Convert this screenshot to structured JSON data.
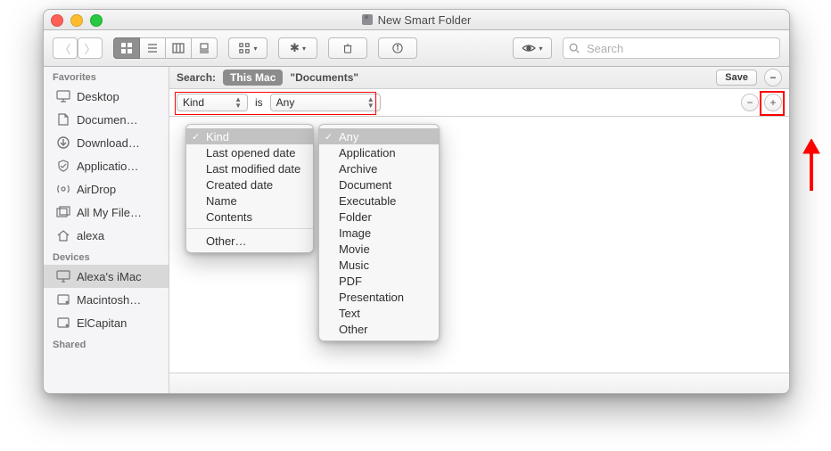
{
  "window": {
    "title": "New Smart Folder"
  },
  "toolbar": {
    "search_placeholder": "Search"
  },
  "sidebar": {
    "groups": [
      {
        "header": "Favorites",
        "items": [
          {
            "label": "Desktop",
            "icon": "desktop"
          },
          {
            "label": "Documen…",
            "icon": "document"
          },
          {
            "label": "Download…",
            "icon": "download"
          },
          {
            "label": "Applicatio…",
            "icon": "app"
          },
          {
            "label": "AirDrop",
            "icon": "airdrop"
          },
          {
            "label": "All My File…",
            "icon": "allfiles"
          },
          {
            "label": "alexa",
            "icon": "home"
          }
        ]
      },
      {
        "header": "Devices",
        "items": [
          {
            "label": "Alexa's iMac",
            "icon": "imac",
            "selected": true
          },
          {
            "label": "Macintosh…",
            "icon": "hdd"
          },
          {
            "label": "ElCapitan",
            "icon": "hdd"
          }
        ]
      },
      {
        "header": "Shared",
        "items": []
      }
    ]
  },
  "searchbar": {
    "label": "Search:",
    "scope_selected": "This Mac",
    "scope_second": "\"Documents\"",
    "save": "Save"
  },
  "criteria": {
    "first_popup": "Kind",
    "verb": "is",
    "second_popup": "Any"
  },
  "menu_kind": {
    "selected": "Kind",
    "items": [
      "Kind",
      "Last opened date",
      "Last modified date",
      "Created date",
      "Name",
      "Contents"
    ],
    "other": "Other…"
  },
  "menu_any": {
    "selected": "Any",
    "items": [
      "Any",
      "Application",
      "Archive",
      "Document",
      "Executable",
      "Folder",
      "Image",
      "Movie",
      "Music",
      "PDF",
      "Presentation",
      "Text",
      "Other"
    ]
  }
}
